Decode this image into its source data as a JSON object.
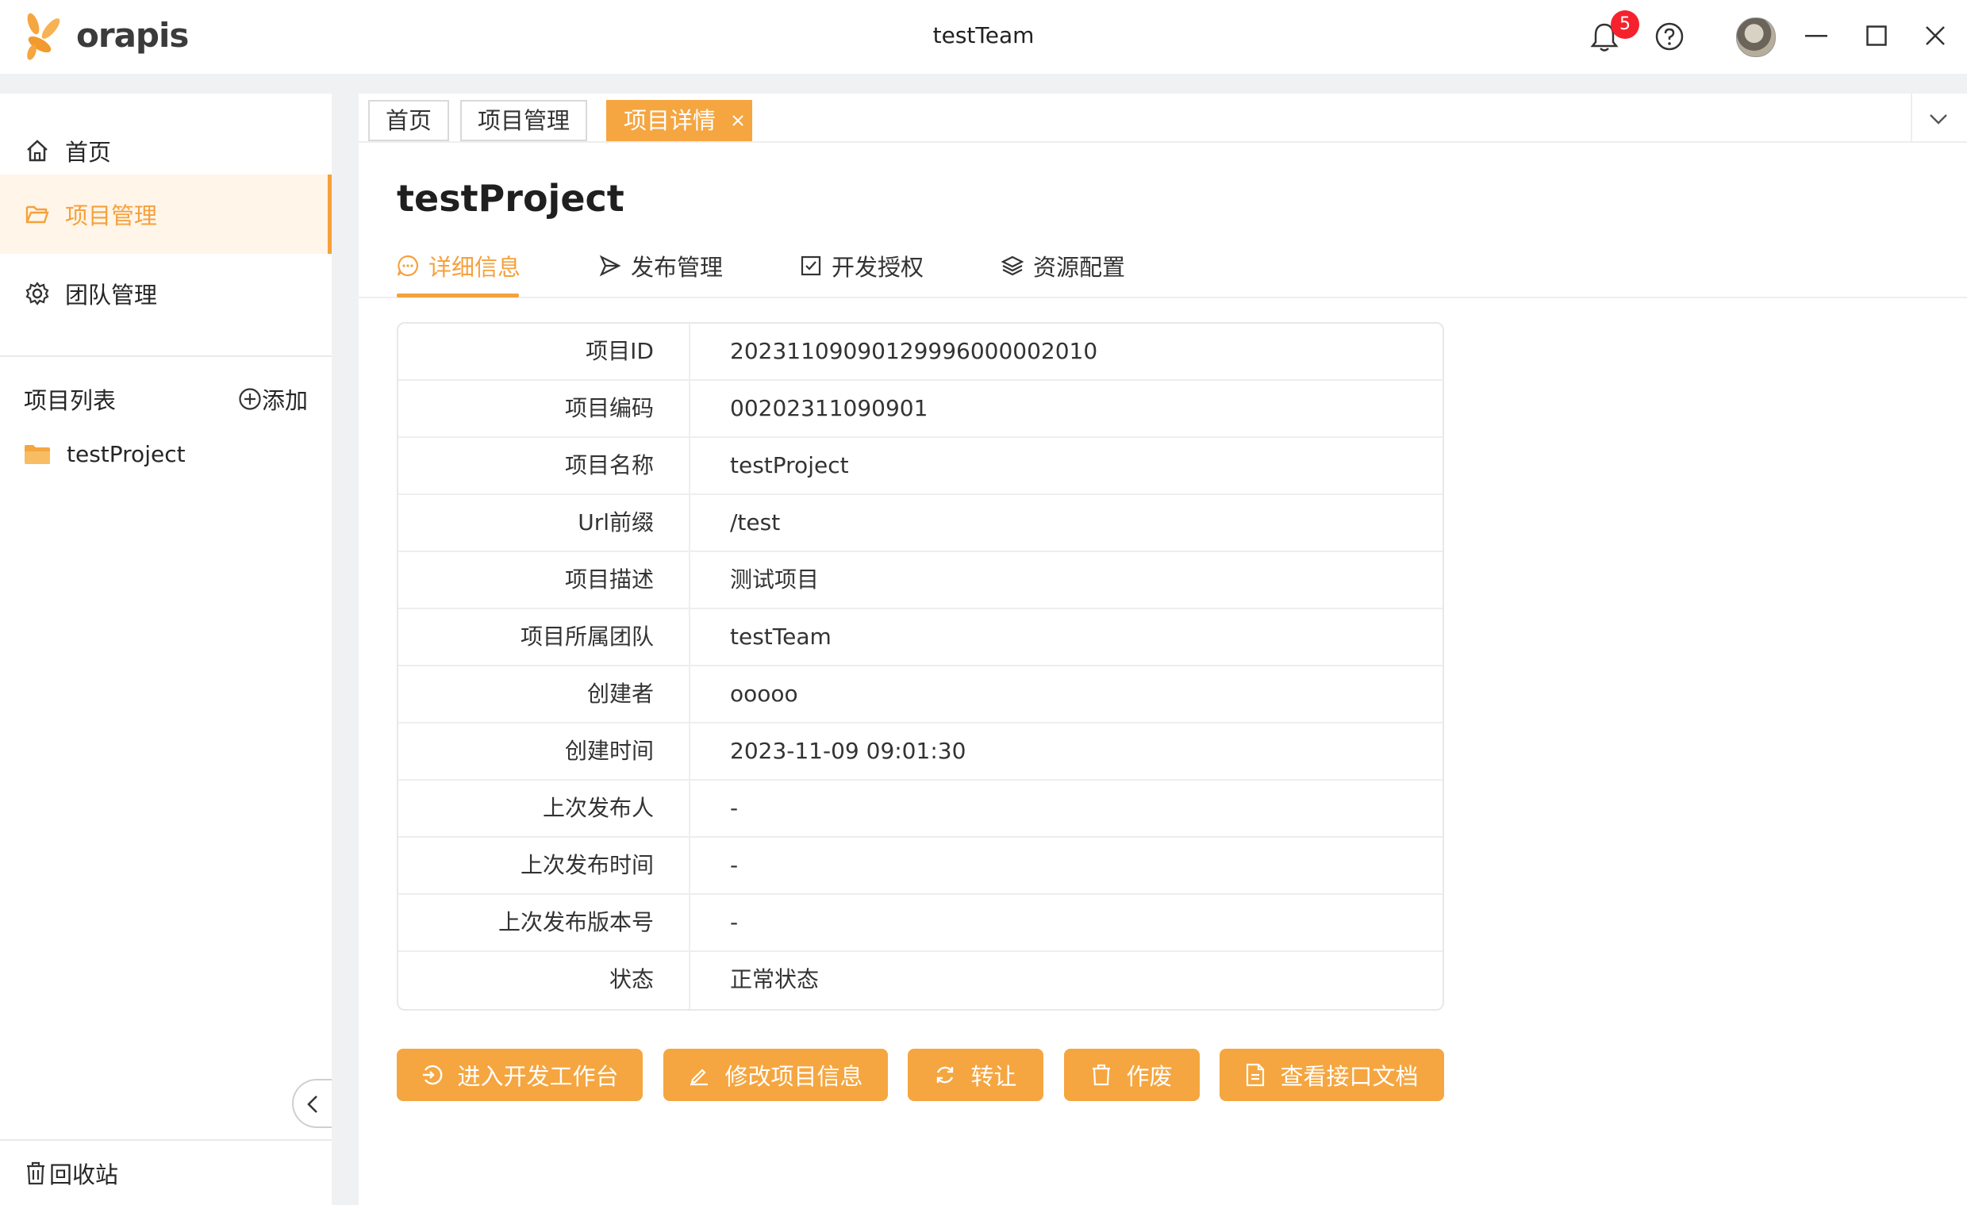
{
  "app": {
    "logo_text": "orapis",
    "window_title": "testTeam",
    "notification_count": "5",
    "brand_color": "#f5a640"
  },
  "sidebar": {
    "items": [
      {
        "label": "首页",
        "icon": "home-icon"
      },
      {
        "label": "项目管理",
        "icon": "folder-open-icon",
        "active": true
      },
      {
        "label": "团队管理",
        "icon": "gear-icon"
      }
    ],
    "project_list_label": "项目列表",
    "add_label": "添加",
    "projects": [
      {
        "name": "testProject",
        "icon": "folder-icon"
      }
    ],
    "recycle_label": "回收站"
  },
  "tabs": [
    {
      "label": "首页"
    },
    {
      "label": "项目管理"
    },
    {
      "label": "项目详情",
      "active": true
    }
  ],
  "project": {
    "title": "testProject",
    "subtabs": [
      {
        "label": "详细信息",
        "icon": "chat-icon",
        "active": true
      },
      {
        "label": "发布管理",
        "icon": "send-icon"
      },
      {
        "label": "开发授权",
        "icon": "checkbox-icon"
      },
      {
        "label": "资源配置",
        "icon": "layers-icon"
      }
    ],
    "details": [
      {
        "label": "项目ID",
        "value": "20231109090129996000002010"
      },
      {
        "label": "项目编码",
        "value": "00202311090901"
      },
      {
        "label": "项目名称",
        "value": "testProject"
      },
      {
        "label": "Url前缀",
        "value": "/test"
      },
      {
        "label": "项目描述",
        "value": "测试项目"
      },
      {
        "label": "项目所属团队",
        "value": "testTeam"
      },
      {
        "label": "创建者",
        "value": "ooooo"
      },
      {
        "label": "创建时间",
        "value": "2023-11-09 09:01:30"
      },
      {
        "label": "上次发布人",
        "value": "-"
      },
      {
        "label": "上次发布时间",
        "value": "-"
      },
      {
        "label": "上次发布版本号",
        "value": "-"
      },
      {
        "label": "状态",
        "value": "正常状态"
      }
    ],
    "actions": [
      {
        "label": "进入开发工作台",
        "icon": "enter-icon"
      },
      {
        "label": "修改项目信息",
        "icon": "edit-icon"
      },
      {
        "label": "转让",
        "icon": "refresh-icon"
      },
      {
        "label": "作废",
        "icon": "trash-icon"
      },
      {
        "label": "查看接口文档",
        "icon": "document-icon"
      }
    ]
  }
}
